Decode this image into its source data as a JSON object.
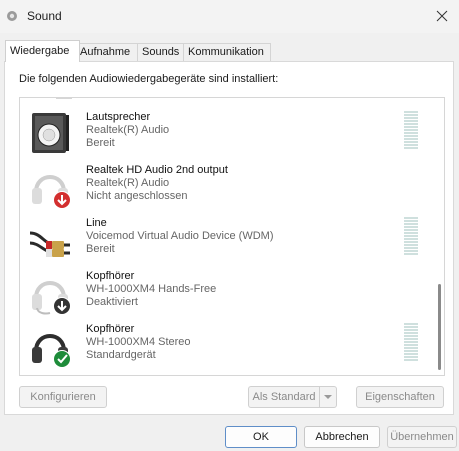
{
  "window": {
    "title": "Sound"
  },
  "tabs": [
    {
      "label": "Wiedergabe"
    },
    {
      "label": "Aufnahme"
    },
    {
      "label": "Sounds"
    },
    {
      "label": "Kommunikation"
    }
  ],
  "playback": {
    "intro": "Die folgenden Audiowiedergabegeräte sind installiert:",
    "devices": [
      {
        "name": "Lautsprecher",
        "driver": "Realtek(R) Audio",
        "status": "Bereit",
        "icon": "speaker-icon"
      },
      {
        "name": "Realtek HD Audio 2nd output",
        "driver": "Realtek(R) Audio",
        "status": "Nicht angeschlossen",
        "icon": "headphones-unplugged-icon"
      },
      {
        "name": "Line",
        "driver": "Voicemod Virtual Audio Device (WDM)",
        "status": "Bereit",
        "icon": "rca-cable-icon"
      },
      {
        "name": "Kopfhörer",
        "driver": "WH-1000XM4 Hands-Free",
        "status": "Deaktiviert",
        "icon": "headset-disabled-icon"
      },
      {
        "name": "Kopfhörer",
        "driver": "WH-1000XM4 Stereo",
        "status": "Standardgerät",
        "icon": "headphones-default-icon"
      }
    ],
    "buttons": {
      "configure": "Konfigurieren",
      "set_default": "Als Standard",
      "properties": "Eigenschaften"
    }
  },
  "dialog_buttons": {
    "ok": "OK",
    "cancel": "Abbrechen",
    "apply": "Übernehmen"
  },
  "colors": {
    "default_badge": "#1e8c3a",
    "disconnected_badge": "#d32f2f",
    "disabled_badge": "#333333",
    "meter": "#cfe0de"
  }
}
